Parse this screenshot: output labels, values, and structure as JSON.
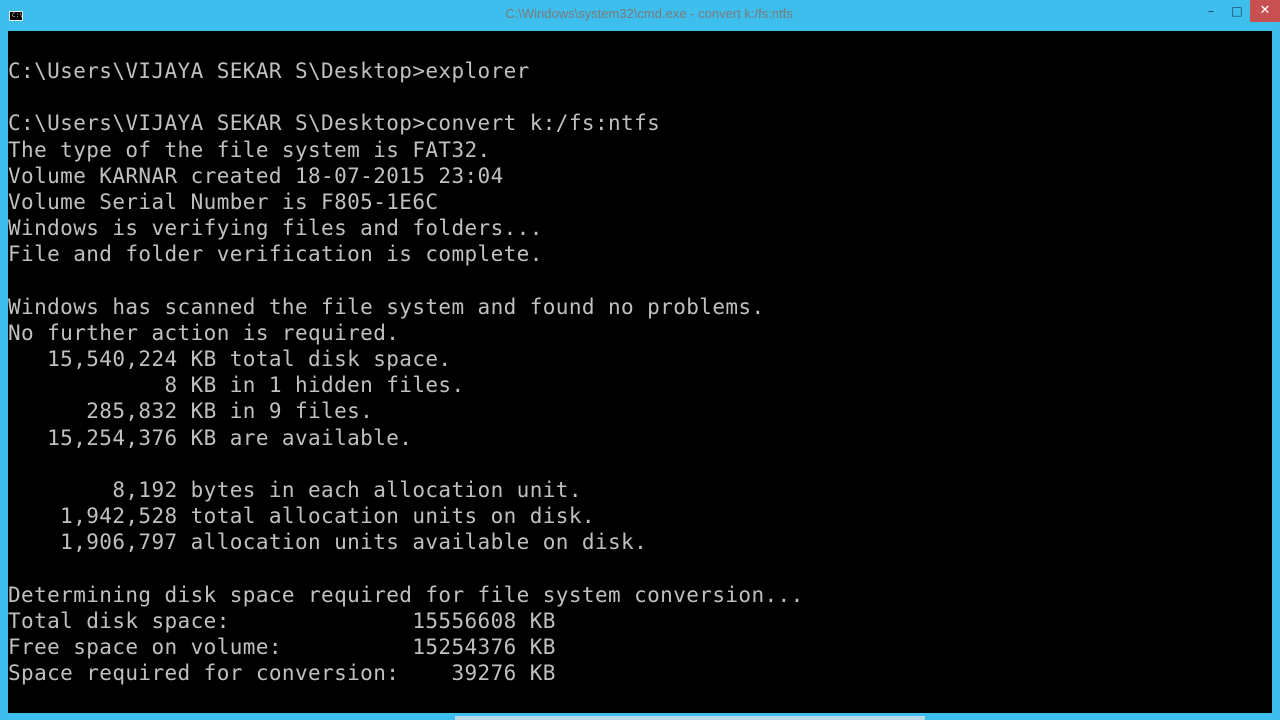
{
  "window": {
    "title": "C:\\Windows\\system32\\cmd.exe - convert  k:/fs:ntfs",
    "icon_text": "C:\\",
    "icon": "cmd-console-icon",
    "controls": {
      "minimize": "–",
      "maximize": "□",
      "close": "✕"
    },
    "colors": {
      "frame": "#3ebeec",
      "console_bg": "#000000",
      "console_text": "#c0c0c0",
      "close_button": "#c75050"
    }
  },
  "console": {
    "lines": [
      "C:\\Users\\VIJAYA SEKAR S\\Desktop>explorer",
      "",
      "C:\\Users\\VIJAYA SEKAR S\\Desktop>convert k:/fs:ntfs",
      "The type of the file system is FAT32.",
      "Volume KARNAR created 18-07-2015 23:04",
      "Volume Serial Number is F805-1E6C",
      "Windows is verifying files and folders...",
      "File and folder verification is complete.",
      "",
      "Windows has scanned the file system and found no problems.",
      "No further action is required.",
      "   15,540,224 KB total disk space.",
      "            8 KB in 1 hidden files.",
      "      285,832 KB in 9 files.",
      "   15,254,376 KB are available.",
      "",
      "        8,192 bytes in each allocation unit.",
      "    1,942,528 total allocation units on disk.",
      "    1,906,797 allocation units available on disk.",
      "",
      "Determining disk space required for file system conversion...",
      "Total disk space:              15556608 KB",
      "Free space on volume:          15254376 KB",
      "Space required for conversion:    39276 KB"
    ]
  }
}
